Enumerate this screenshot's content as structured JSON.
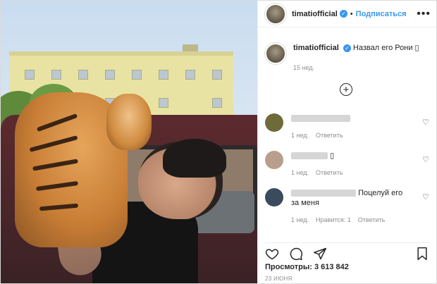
{
  "header": {
    "username": "timatiofficial",
    "separator": "•",
    "follow_label": "Подписаться",
    "more_label": "•••"
  },
  "caption": {
    "username": "timatiofficial",
    "text": "Назвал его Рони ▯",
    "time": "15 нед."
  },
  "load_more_label": "+",
  "comments": [
    {
      "text": "",
      "meta_time": "1 нед.",
      "reply_label": "Ответить",
      "avatar_color": "#6f6a3a"
    },
    {
      "text": "▯",
      "meta_time": "1 нед.",
      "reply_label": "Ответить",
      "avatar_color": "#b99d8d"
    },
    {
      "text": "Поцелуй его за меня",
      "meta_time": "1 нед.",
      "likes_label": "Нравится: 1",
      "reply_label": "Ответить",
      "avatar_color": "#3a4c5c"
    }
  ],
  "views": "Просмотры: 3 613 842",
  "date": "23 ИЮНЯ",
  "colors": {
    "accent": "#3897f0",
    "muted": "#8e8e8e",
    "text": "#262626"
  },
  "icons": [
    "verified-icon",
    "more-icon",
    "load-more-icon",
    "heart-icon",
    "comment-icon",
    "share-icon",
    "bookmark-icon"
  ]
}
